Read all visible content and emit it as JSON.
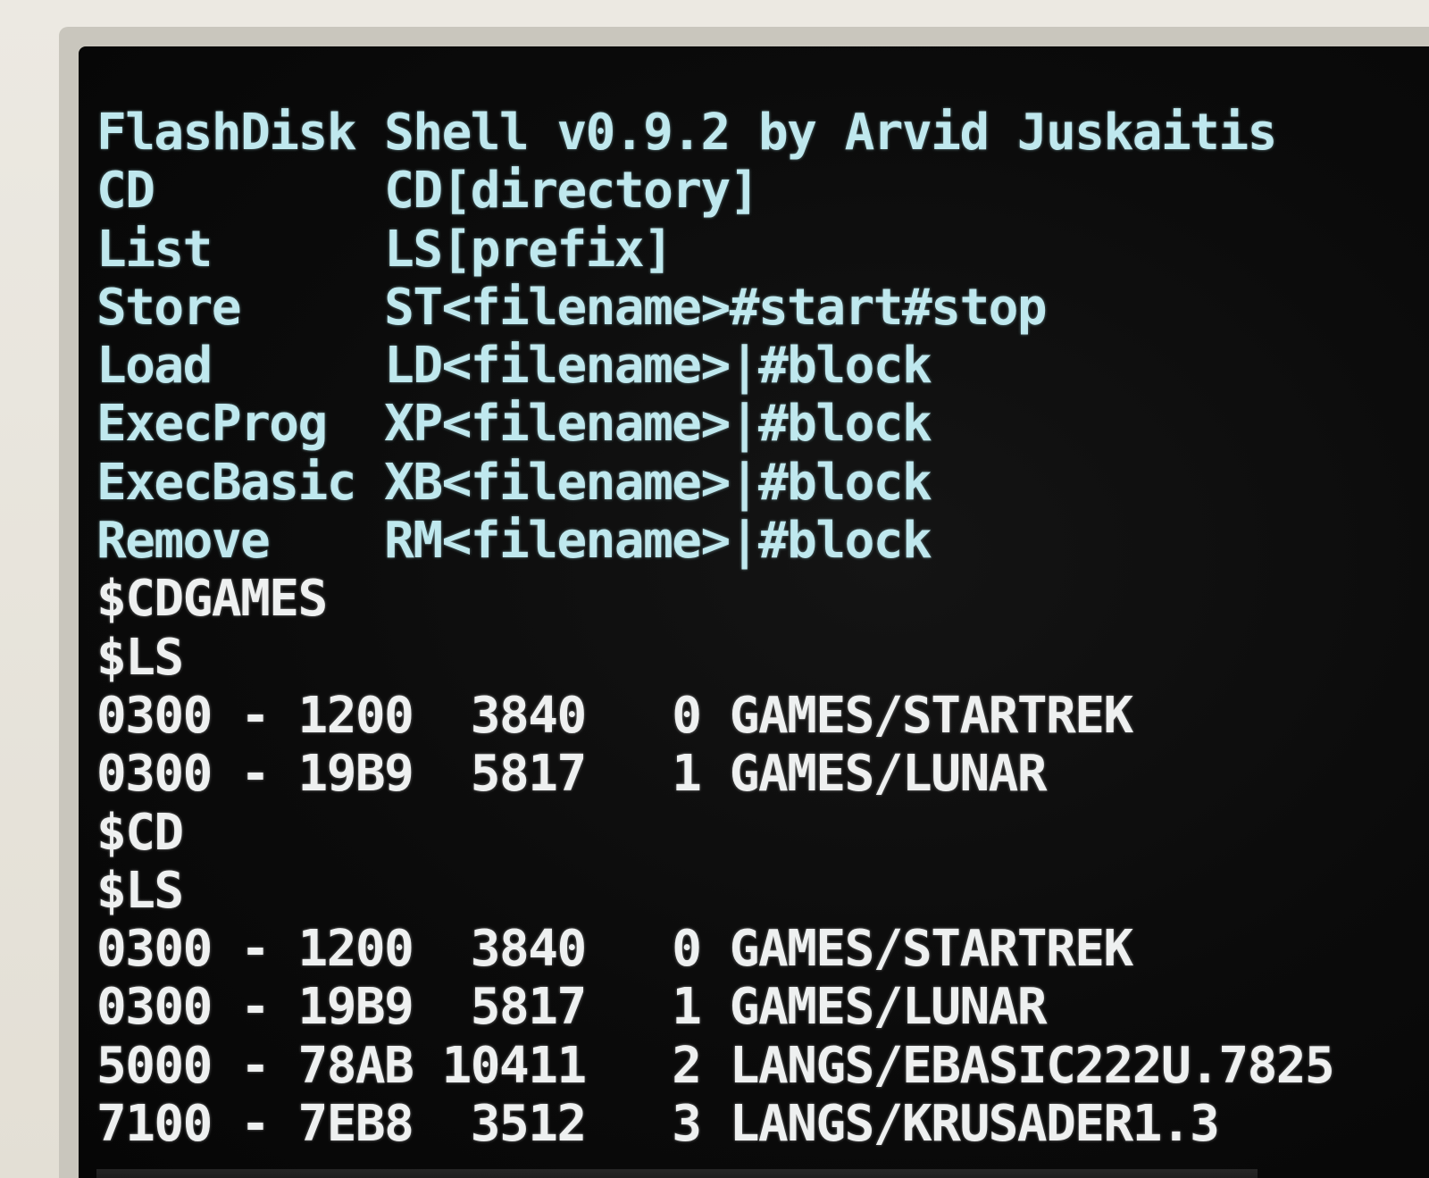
{
  "terminal": {
    "lines": [
      {
        "text": "FlashDisk Shell v0.9.2 by Arvid Juskaitis",
        "color": "cyan"
      },
      {
        "text": "CD        CD[directory]",
        "color": "cyan"
      },
      {
        "text": "List      LS[prefix]",
        "color": "cyan"
      },
      {
        "text": "Store     ST<filename>#start#stop",
        "color": "cyan"
      },
      {
        "text": "Load      LD<filename>|#block",
        "color": "cyan"
      },
      {
        "text": "ExecProg  XP<filename>|#block",
        "color": "cyan"
      },
      {
        "text": "ExecBasic XB<filename>|#block",
        "color": "cyan"
      },
      {
        "text": "Remove    RM<filename>|#block",
        "color": "cyan"
      },
      {
        "text": "$CDGAMES",
        "color": "white"
      },
      {
        "text": "$LS",
        "color": "white"
      },
      {
        "text": "0300 - 1200  3840   0 GAMES/STARTREK",
        "color": "white"
      },
      {
        "text": "0300 - 19B9  5817   1 GAMES/LUNAR",
        "color": "white"
      },
      {
        "text": "$CD",
        "color": "white"
      },
      {
        "text": "$LS",
        "color": "white"
      },
      {
        "text": "0300 - 1200  3840   0 GAMES/STARTREK",
        "color": "white"
      },
      {
        "text": "0300 - 19B9  5817   1 GAMES/LUNAR",
        "color": "white"
      },
      {
        "text": "5000 - 78AB 10411   2 LANGS/EBASIC222U.7825",
        "color": "white"
      },
      {
        "text": "7100 - 7EB8  3512   3 LANGS/KRUSADER1.3",
        "color": "white"
      }
    ]
  },
  "colors": {
    "screen_background": "#0b0b0b",
    "cyan_text": "#bfe8ee",
    "white_text": "#eef0f0",
    "bezel": "#e9e5dc"
  }
}
